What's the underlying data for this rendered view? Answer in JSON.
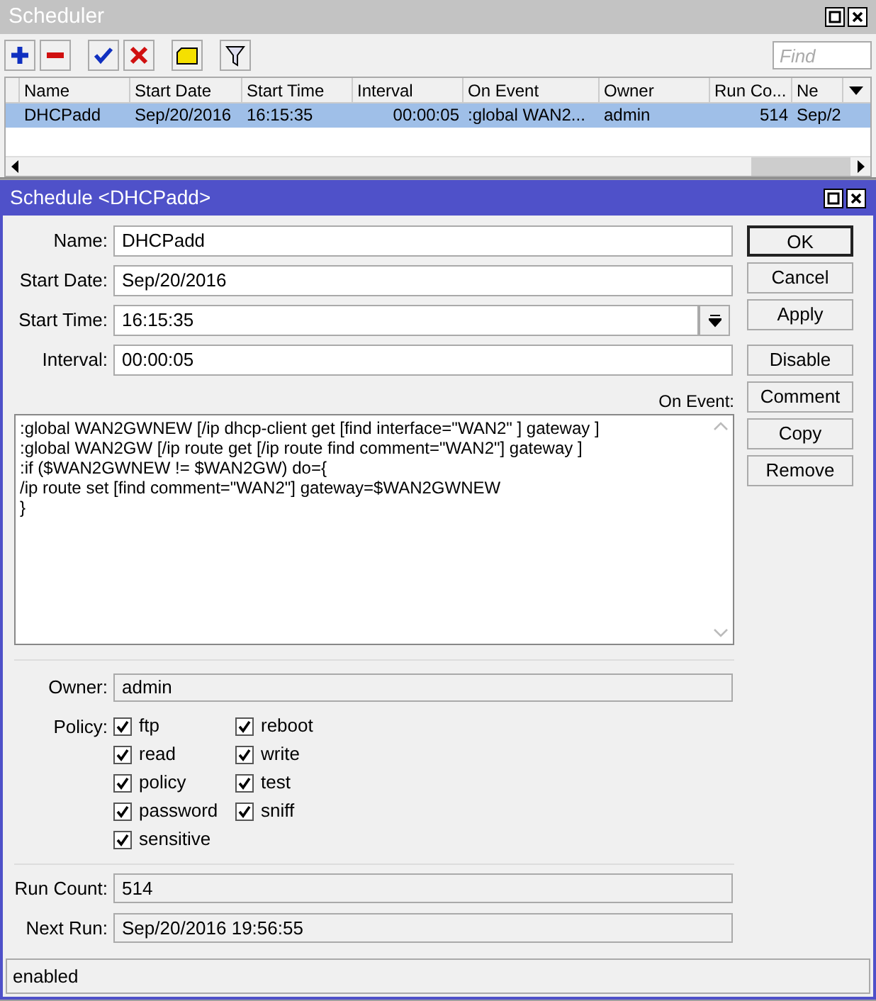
{
  "scheduler": {
    "title": "Scheduler",
    "find": {
      "placeholder": "Find"
    },
    "columns": [
      "Name",
      "Start Date",
      "Start Time",
      "Interval",
      "On Event",
      "Owner",
      "Run Co...",
      "Ne"
    ],
    "rows": [
      {
        "selected": true,
        "cells": [
          "DHCPadd",
          "Sep/20/2016",
          "16:15:35",
          "00:00:05",
          ":global WAN2...",
          "admin",
          "514",
          "Sep/2"
        ]
      }
    ]
  },
  "dialog": {
    "title": "Schedule <DHCPadd>",
    "fields": [
      {
        "label": "Name:",
        "value": "DHCPadd",
        "kind": "text"
      },
      {
        "label": "Start Date:",
        "value": "Sep/20/2016",
        "kind": "text"
      },
      {
        "label": "Start Time:",
        "value": "16:15:35",
        "kind": "dropdown"
      },
      {
        "label": "Interval:",
        "value": "00:00:05",
        "kind": "text"
      }
    ],
    "on_event": {
      "label": "On Event:",
      "lines": [
        ":global WAN2GWNEW [/ip dhcp-client get [find interface=\"WAN2\" ] gateway ]",
        ":global WAN2GW [/ip route get [/ip route find comment=\"WAN2\"] gateway ]",
        ":if ($WAN2GWNEW != $WAN2GW) do={",
        "/ip route set [find comment=\"WAN2\"] gateway=$WAN2GWNEW",
        "}"
      ]
    },
    "owner": {
      "label": "Owner:",
      "value": "admin"
    },
    "policy": {
      "label": "Policy:",
      "items": [
        {
          "label": "ftp",
          "checked": true
        },
        {
          "label": "reboot",
          "checked": true
        },
        {
          "label": "read",
          "checked": true
        },
        {
          "label": "write",
          "checked": true
        },
        {
          "label": "policy",
          "checked": true
        },
        {
          "label": "test",
          "checked": true
        },
        {
          "label": "password",
          "checked": true
        },
        {
          "label": "sniff",
          "checked": true
        },
        {
          "label": "sensitive",
          "checked": true
        }
      ]
    },
    "run_count": {
      "label": "Run Count:",
      "value": "514"
    },
    "next_run": {
      "label": "Next Run:",
      "value": "Sep/20/2016 19:56:55"
    },
    "buttons": [
      "OK",
      "Cancel",
      "Apply",
      "Disable",
      "Comment",
      "Copy",
      "Remove"
    ],
    "status": "enabled"
  }
}
